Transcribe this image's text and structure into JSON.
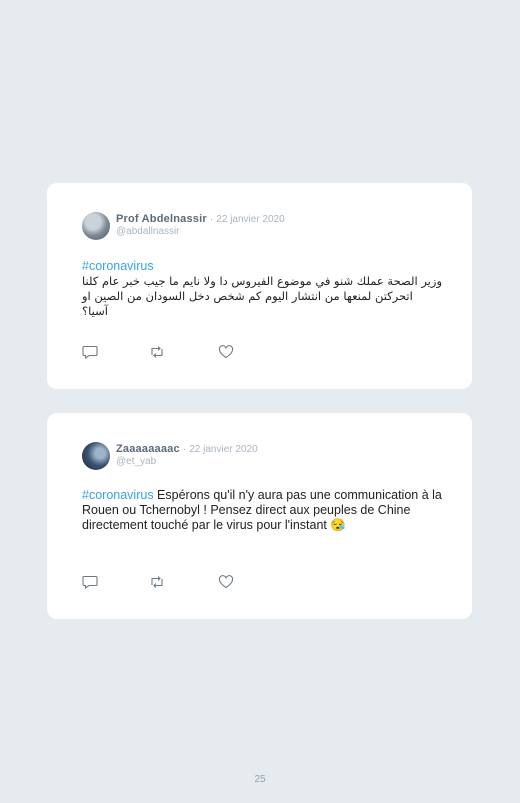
{
  "tweets": [
    {
      "name": "Prof Abdelnassir",
      "separator": "·",
      "date": "22 janvier 2020",
      "handle": "@abdallnassir",
      "hashtag": "#coronavirus",
      "body": "وزير الصحة عملك شنو في موضوع الفيروس دا ولا نايم ما جيب خبر عام كلنا اتحركتن لمنعها من انتشار اليوم كم شخص دخل السودان من الصين او آسيا؟",
      "avatar_icon": "profile-photo"
    },
    {
      "name": "Zaaaaaaaac",
      "separator": "·",
      "date": "22 janvier 2020",
      "handle": "@et_yab",
      "hashtag": "#coronavirus",
      "body": " Espérons qu'il n'y aura pas une communication à la Rouen ou Tchernobyl ! Pensez direct aux peuples de Chine directement touché par le virus pour l'instant 😪",
      "avatar_icon": "profile-photo"
    }
  ],
  "actions": {
    "reply_icon": "reply-icon",
    "retweet_icon": "retweet-icon",
    "like_icon": "heart-icon"
  },
  "footer": {
    "page_number": "25"
  },
  "colors": {
    "background": "#e6ebf0",
    "card": "#ffffff",
    "hashtag": "#3aa3e3",
    "meta": "#aab5bf"
  }
}
